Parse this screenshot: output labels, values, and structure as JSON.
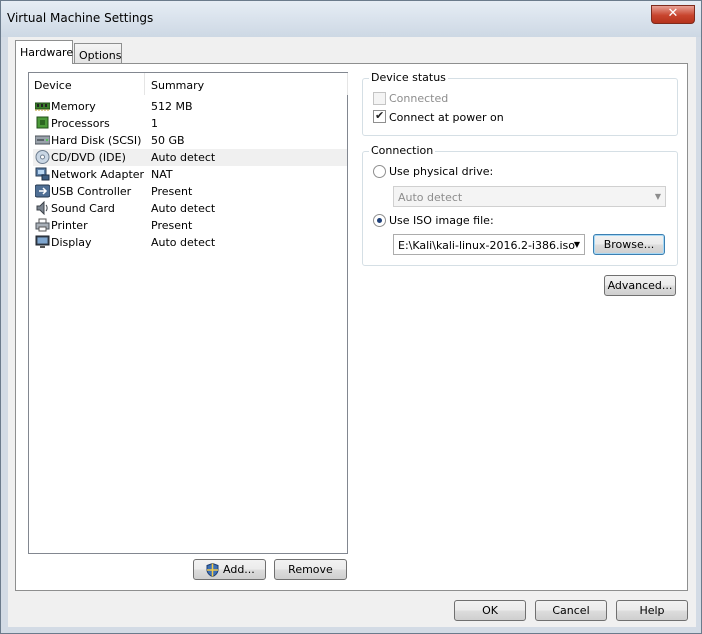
{
  "window": {
    "title": "Virtual Machine Settings",
    "close_glyph": "✕"
  },
  "tabs": [
    {
      "label": "Hardware"
    },
    {
      "label": "Options"
    }
  ],
  "device_list": {
    "columns": {
      "device": "Device",
      "summary": "Summary"
    },
    "rows": [
      {
        "name": "Memory",
        "summary": "512 MB",
        "icon": "memory-icon"
      },
      {
        "name": "Processors",
        "summary": "1",
        "icon": "processor-icon"
      },
      {
        "name": "Hard Disk (SCSI)",
        "summary": "50 GB",
        "icon": "hard-disk-icon"
      },
      {
        "name": "CD/DVD (IDE)",
        "summary": "Auto detect",
        "icon": "cd-dvd-icon",
        "selected": true
      },
      {
        "name": "Network Adapter",
        "summary": "NAT",
        "icon": "network-adapter-icon"
      },
      {
        "name": "USB Controller",
        "summary": "Present",
        "icon": "usb-controller-icon"
      },
      {
        "name": "Sound Card",
        "summary": "Auto detect",
        "icon": "sound-card-icon"
      },
      {
        "name": "Printer",
        "summary": "Present",
        "icon": "printer-icon"
      },
      {
        "name": "Display",
        "summary": "Auto detect",
        "icon": "display-icon"
      }
    ]
  },
  "list_buttons": {
    "add": "Add...",
    "remove": "Remove"
  },
  "device_status": {
    "title": "Device status",
    "connected": {
      "label": "Connected",
      "checked": false,
      "enabled": false
    },
    "connect_at_power_on": {
      "label": "Connect at power on",
      "checked": true
    }
  },
  "connection": {
    "title": "Connection",
    "physical_drive": {
      "label": "Use physical drive:",
      "selected": false
    },
    "physical_drive_value": "Auto detect",
    "iso_image": {
      "label": "Use ISO image file:",
      "selected": true
    },
    "iso_path": "E:\\Kali\\kali-linux-2016.2-i386.iso",
    "browse": "Browse..."
  },
  "advanced_button": "Advanced...",
  "dialog_buttons": {
    "ok": "OK",
    "cancel": "Cancel",
    "help": "Help"
  }
}
